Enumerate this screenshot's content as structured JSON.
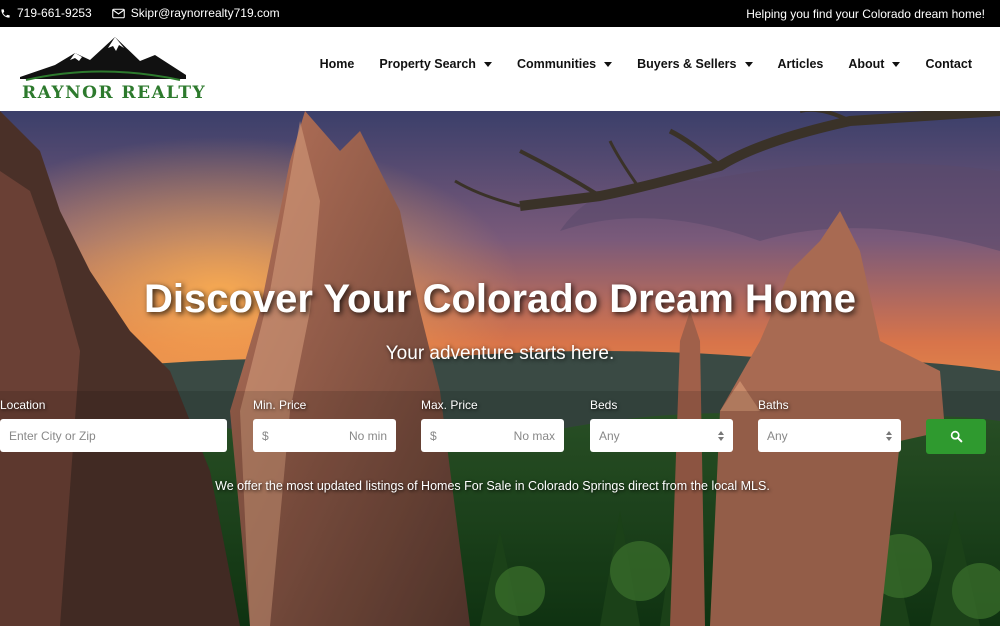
{
  "topbar": {
    "phone": "719-661-9253",
    "email": "Skipr@raynorrealty719.com",
    "tagline": "Helping you find your Colorado dream home!"
  },
  "logo": {
    "text": "RAYNOR REALTY"
  },
  "nav": {
    "items": [
      {
        "label": "Home",
        "dropdown": false
      },
      {
        "label": "Property Search",
        "dropdown": true
      },
      {
        "label": "Communities",
        "dropdown": true
      },
      {
        "label": "Buyers & Sellers",
        "dropdown": true
      },
      {
        "label": "Articles",
        "dropdown": false
      },
      {
        "label": "About",
        "dropdown": true
      },
      {
        "label": "Contact",
        "dropdown": false
      }
    ]
  },
  "hero": {
    "title": "Discover Your Colorado Dream Home",
    "subtitle": "Your adventure starts here.",
    "note": "We offer the most updated listings of  Homes For Sale in Colorado Springs direct from the local MLS."
  },
  "search": {
    "location": {
      "label": "Location",
      "placeholder": "Enter City or Zip"
    },
    "min_price": {
      "label": "Min. Price",
      "prefix": "$",
      "placeholder": "No min"
    },
    "max_price": {
      "label": "Max. Price",
      "prefix": "$",
      "placeholder": "No max"
    },
    "beds": {
      "label": "Beds",
      "value": "Any"
    },
    "baths": {
      "label": "Baths",
      "value": "Any"
    },
    "button_icon": "search-icon"
  },
  "colors": {
    "brand_green": "#2f9a2f",
    "topbar_bg": "#000000"
  }
}
